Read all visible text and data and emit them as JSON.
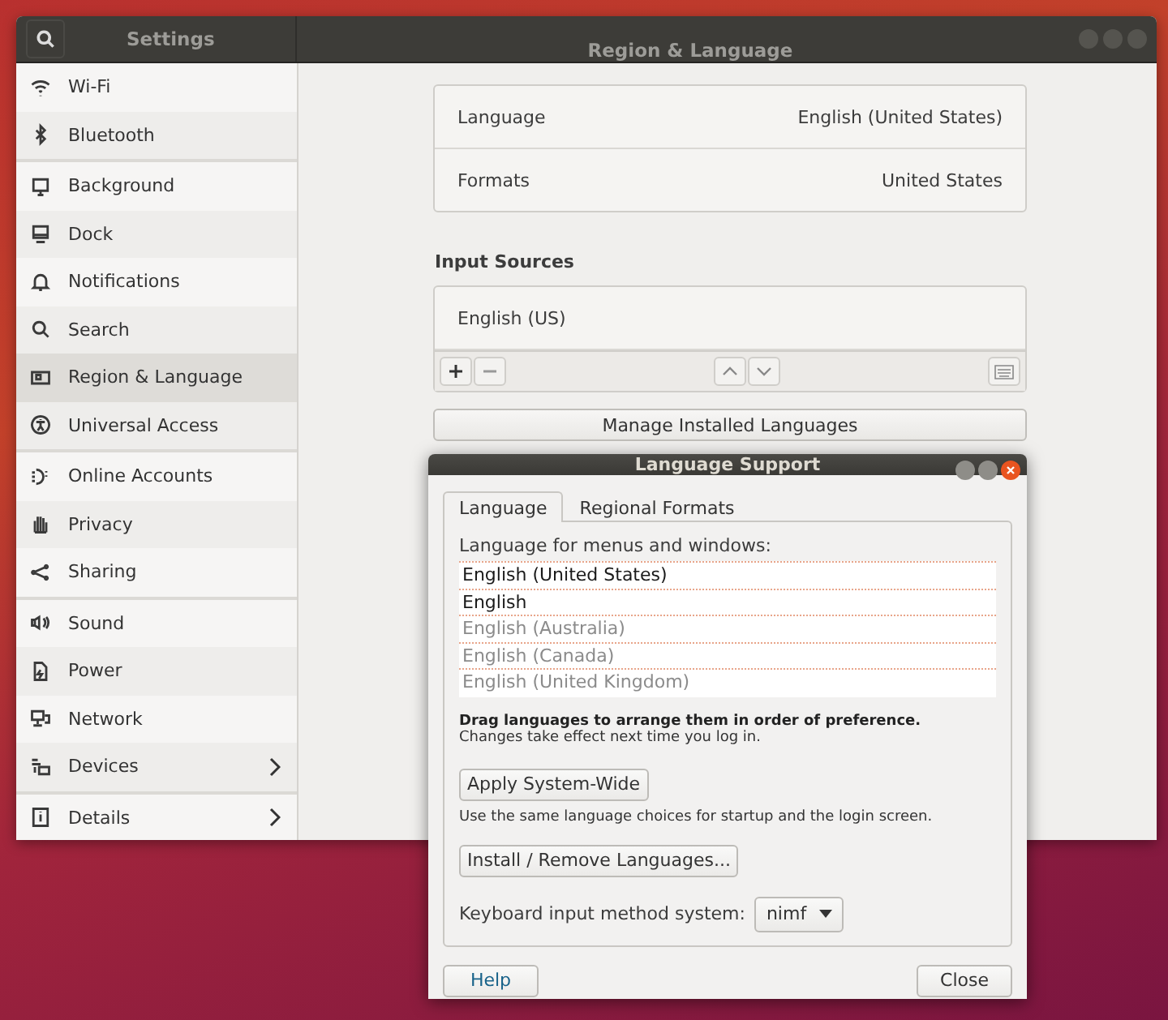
{
  "settings_window": {
    "sidebar_title": "Settings",
    "title": "Region & Language"
  },
  "sidebar": {
    "groups": [
      {
        "items": [
          {
            "label": "Wi-Fi",
            "selected": false,
            "submenu": false
          },
          {
            "label": "Bluetooth",
            "selected": false,
            "submenu": false
          }
        ]
      },
      {
        "items": [
          {
            "label": "Background",
            "selected": false,
            "submenu": false
          },
          {
            "label": "Dock",
            "selected": false,
            "submenu": false
          },
          {
            "label": "Notifications",
            "selected": false,
            "submenu": false
          },
          {
            "label": "Search",
            "selected": false,
            "submenu": false
          },
          {
            "label": "Region & Language",
            "selected": true,
            "submenu": false
          },
          {
            "label": "Universal Access",
            "selected": false,
            "submenu": false
          }
        ]
      },
      {
        "items": [
          {
            "label": "Online Accounts",
            "selected": false,
            "submenu": false
          },
          {
            "label": "Privacy",
            "selected": false,
            "submenu": false
          },
          {
            "label": "Sharing",
            "selected": false,
            "submenu": false
          }
        ]
      },
      {
        "items": [
          {
            "label": "Sound",
            "selected": false,
            "submenu": false
          },
          {
            "label": "Power",
            "selected": false,
            "submenu": false
          },
          {
            "label": "Network",
            "selected": false,
            "submenu": false
          },
          {
            "label": "Devices",
            "selected": false,
            "submenu": true
          }
        ]
      },
      {
        "items": [
          {
            "label": "Details",
            "selected": false,
            "submenu": true
          }
        ]
      }
    ]
  },
  "region": {
    "rows": [
      {
        "label": "Language",
        "value": "English (United States)"
      },
      {
        "label": "Formats",
        "value": "United States"
      }
    ]
  },
  "input_sources": {
    "heading": "Input Sources",
    "items": [
      "English (US)"
    ]
  },
  "manage_button": "Manage Installed Languages",
  "dialog": {
    "title": "Language Support",
    "tabs": [
      {
        "label": "Language",
        "selected": true
      },
      {
        "label": "Regional Formats",
        "selected": false
      }
    ],
    "list_label": "Language for menus and windows:",
    "languages": [
      {
        "name": "English (United States)",
        "dimmed": false
      },
      {
        "name": "English",
        "dimmed": false
      },
      {
        "name": "English (Australia)",
        "dimmed": true
      },
      {
        "name": "English (Canada)",
        "dimmed": true
      },
      {
        "name": "English (United Kingdom)",
        "dimmed": true
      }
    ],
    "hint_bold": "Drag languages to arrange them in order of preference.",
    "hint": "Changes take effect next time you log in.",
    "apply_button": "Apply System-Wide",
    "apply_note": "Use the same language choices for startup and the login screen.",
    "install_button": "Install / Remove Languages...",
    "im_label": "Keyboard input method system:",
    "im_value": "nimf",
    "help_button": "Help",
    "close_button": "Close"
  }
}
